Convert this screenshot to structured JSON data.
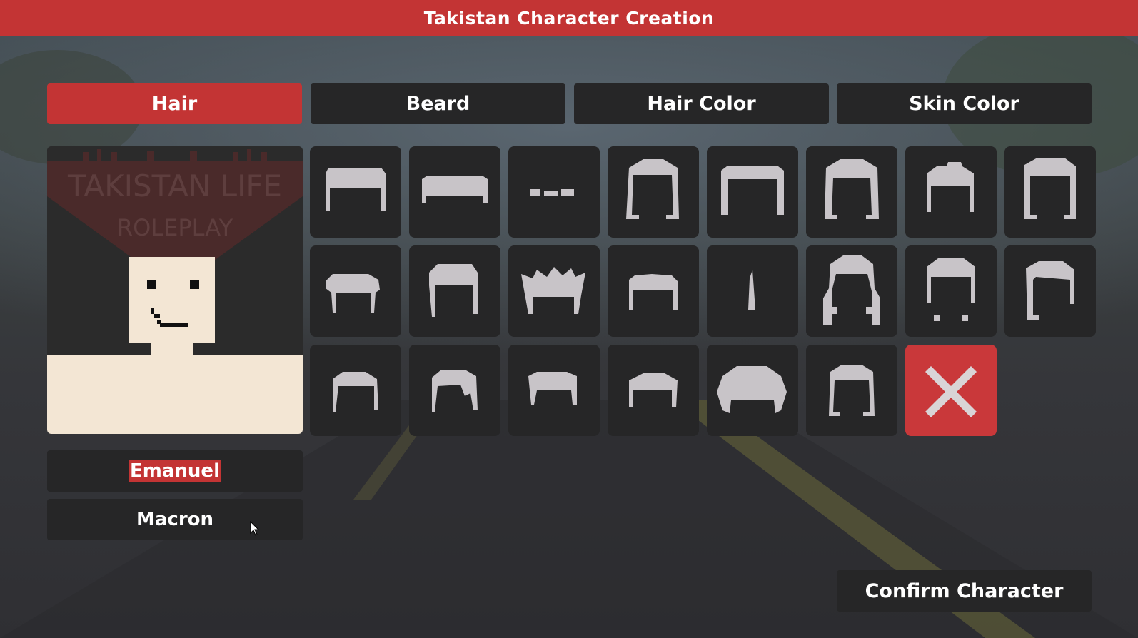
{
  "window": {
    "title": "Takistan Character Creation"
  },
  "tabs": [
    {
      "label": "Hair",
      "active": true
    },
    {
      "label": "Beard",
      "active": false
    },
    {
      "label": "Hair Color",
      "active": false
    },
    {
      "label": "Skin Color",
      "active": false
    }
  ],
  "preview": {
    "logo_line1": "TAKISTAN LIFE",
    "logo_line2": "ROLEPLAY",
    "skin_color": "#f3e6d4"
  },
  "name": {
    "first": "Emanuel",
    "last": "Macron"
  },
  "hair_options": [
    "hair-style-1",
    "hair-style-2",
    "hair-style-3",
    "hair-style-4",
    "hair-style-5",
    "hair-style-6",
    "hair-style-7",
    "hair-style-8",
    "hair-style-9",
    "hair-style-10",
    "hair-style-11",
    "hair-style-12",
    "hair-style-13",
    "hair-style-14",
    "hair-style-15",
    "hair-style-16",
    "hair-style-17",
    "hair-style-18",
    "hair-style-19",
    "hair-style-20",
    "hair-style-21",
    "hair-style-22",
    "remove-hair-icon"
  ],
  "confirm_label": "Confirm Character",
  "colors": {
    "accent": "#c33434",
    "panel": "#262627",
    "hair_icon": "#c8c4c8"
  }
}
